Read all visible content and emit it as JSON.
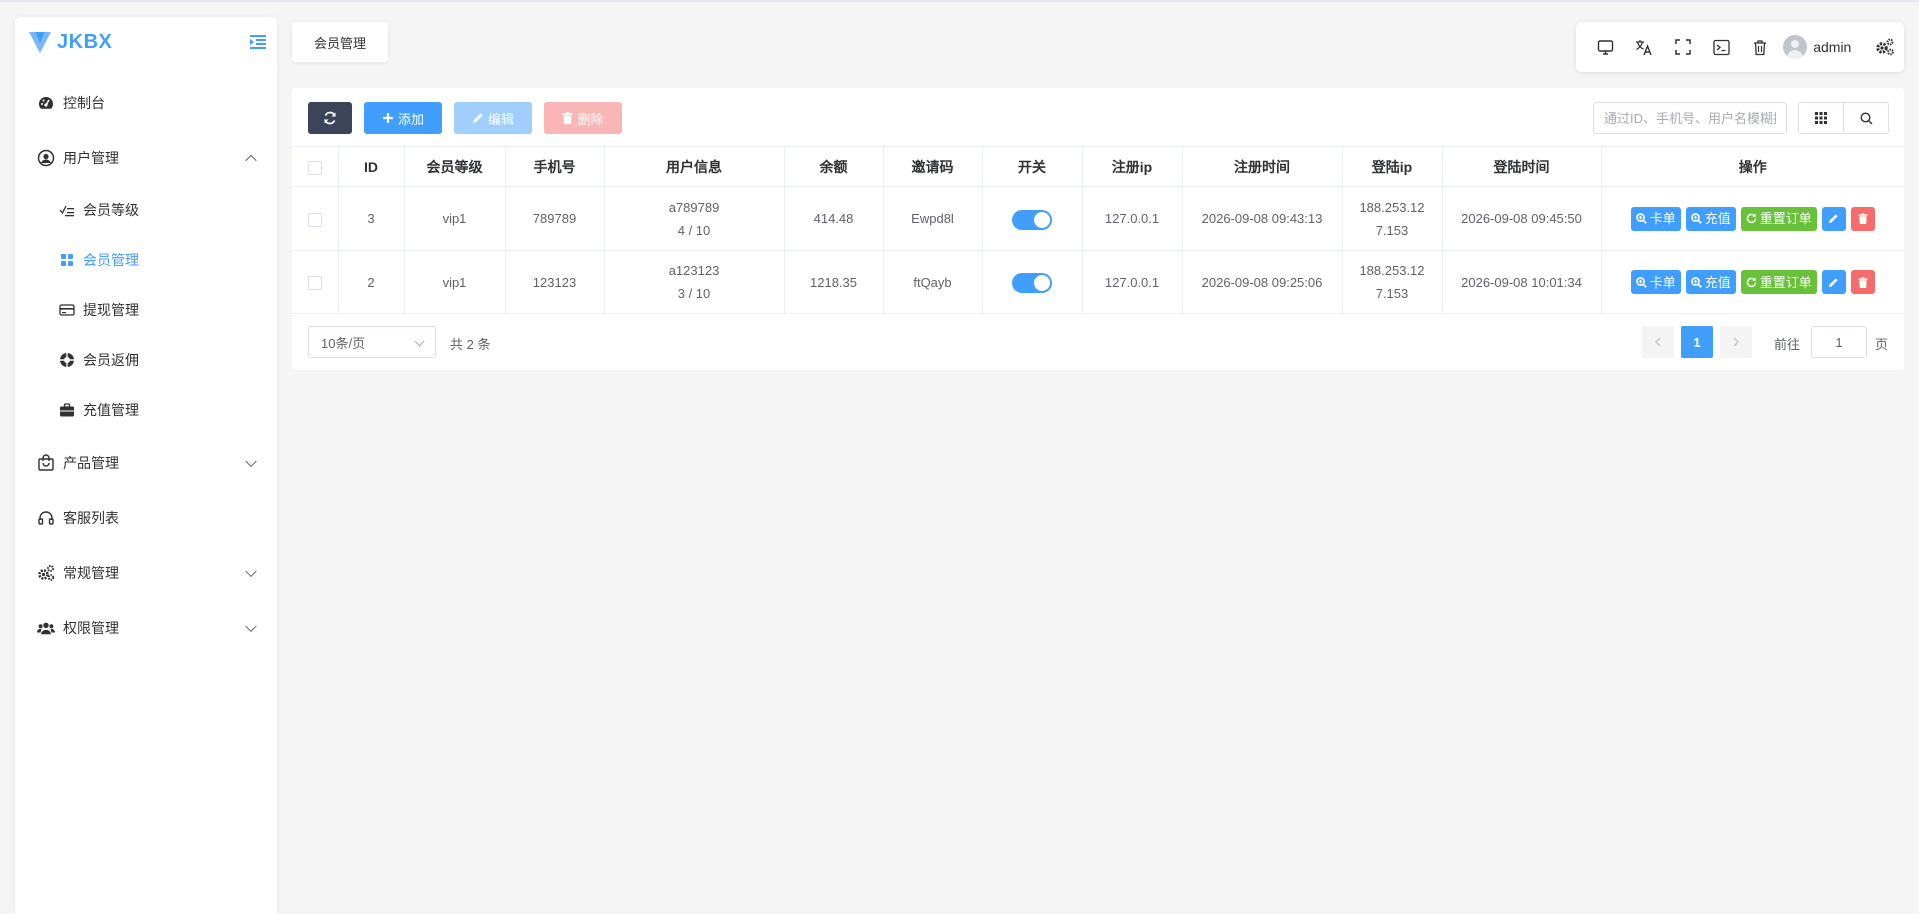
{
  "app": {
    "logo_text": "JKBX"
  },
  "sidebar": {
    "items": [
      {
        "label": "控制台",
        "icon": "dashboard-icon"
      },
      {
        "label": "用户管理",
        "icon": "user-circle-icon",
        "expanded": true,
        "children": [
          {
            "label": "会员等级",
            "icon": "list-check-icon"
          },
          {
            "label": "会员管理",
            "icon": "grid-icon",
            "active": true
          },
          {
            "label": "提现管理",
            "icon": "credit-card-icon"
          },
          {
            "label": "会员返佣",
            "icon": "lifebuoy-icon"
          },
          {
            "label": "充值管理",
            "icon": "briefcase-icon"
          }
        ]
      },
      {
        "label": "产品管理",
        "icon": "shopping-bag-icon",
        "expanded": false
      },
      {
        "label": "客服列表",
        "icon": "headset-icon"
      },
      {
        "label": "常规管理",
        "icon": "cogs-icon",
        "expanded": false
      },
      {
        "label": "权限管理",
        "icon": "users-icon",
        "expanded": false
      }
    ]
  },
  "tags": {
    "current": "会员管理"
  },
  "header": {
    "username": "admin"
  },
  "toolbar": {
    "add_label": "添加",
    "edit_label": "编辑",
    "delete_label": "删除",
    "search_placeholder": "通过ID、手机号、用户名模糊搜索"
  },
  "table": {
    "columns": [
      "ID",
      "会员等级",
      "手机号",
      "用户信息",
      "余额",
      "邀请码",
      "开关",
      "注册ip",
      "注册时间",
      "登陆ip",
      "登陆时间",
      "操作"
    ],
    "rows": [
      {
        "id": "3",
        "level": "vip1",
        "phone": "789789",
        "user_name": "a789789",
        "user_progress": "4 / 10",
        "balance": "414.48",
        "invite_code": "Ewpd8l",
        "switch_on": true,
        "reg_ip": "127.0.0.1",
        "reg_time": "2026-09-08 09:43:13",
        "login_ip_line1": "188.253.12",
        "login_ip_line2": "7.153",
        "login_time": "2026-09-08 09:45:50"
      },
      {
        "id": "2",
        "level": "vip1",
        "phone": "123123",
        "user_name": "a123123",
        "user_progress": "3 / 10",
        "balance": "1218.35",
        "invite_code": "ftQayb",
        "switch_on": true,
        "reg_ip": "127.0.0.1",
        "reg_time": "2026-09-08 09:25:06",
        "login_ip_line1": "188.253.12",
        "login_ip_line2": "7.153",
        "login_time": "2026-09-08 10:01:34"
      }
    ],
    "actions": {
      "card": "卡单",
      "recharge": "充值",
      "reset": "重置订单"
    }
  },
  "pagination": {
    "page_size": "10条/页",
    "total": "共 2 条",
    "current": "1",
    "goto_label": "前往",
    "goto_value": "1",
    "goto_suffix": "页"
  },
  "colors": {
    "primary": "#409eff",
    "success": "#67c23a",
    "danger": "#f56c6c",
    "dark": "#3b4458"
  }
}
